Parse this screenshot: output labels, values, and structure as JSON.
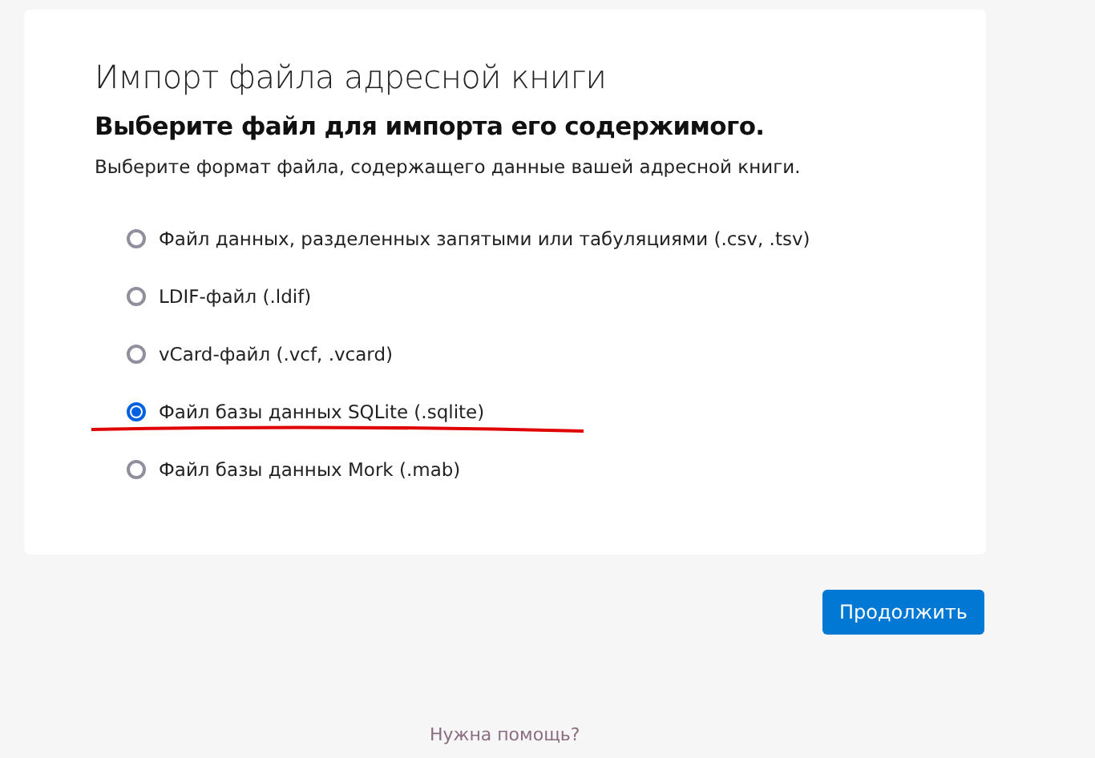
{
  "title": "Импорт файла адресной книги",
  "heading": "Выберите файл для импорта его содержимого.",
  "description": "Выберите формат файла, содержащего данные вашей адресной книги.",
  "options": [
    {
      "label": "Файл данных, разделенных запятыми или табуляциями (.csv, .tsv)",
      "selected": false
    },
    {
      "label": "LDIF-файл (.ldif)",
      "selected": false
    },
    {
      "label": "vCard-файл (.vcf, .vcard)",
      "selected": false
    },
    {
      "label": "Файл базы данных SQLite (.sqlite)",
      "selected": true
    },
    {
      "label": "Файл базы данных Mork (.mab)",
      "selected": false
    }
  ],
  "continue_button": "Продолжить",
  "help_link": "Нужна помощь?"
}
